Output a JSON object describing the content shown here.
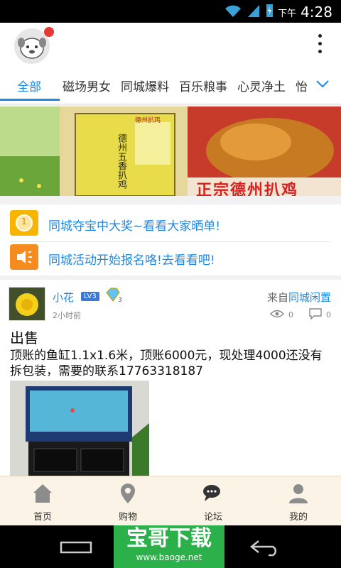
{
  "status_bar": {
    "period": "下午",
    "time": "4:28"
  },
  "tabs": {
    "items": [
      {
        "label": "全部",
        "active": true
      },
      {
        "label": "磁场男女"
      },
      {
        "label": "同城爆料"
      },
      {
        "label": "百乐粮事"
      },
      {
        "label": "心灵净土"
      },
      {
        "label": "怡"
      }
    ],
    "accent_color": "#1e88e5"
  },
  "banner": {
    "caption": "正宗德州扒鸡",
    "package_text": "德州五香扒鸡",
    "package_brand": "德州扒鸡"
  },
  "notices": [
    {
      "icon": "coin-icon",
      "icon_text": "1",
      "text": "同城夺宝中大奖~看看大家晒单!"
    },
    {
      "icon": "speaker-icon",
      "text": "同城活动开始报名咯!去看看吧!"
    }
  ],
  "post": {
    "username": "小花",
    "level": "LV3",
    "badge_number": "3",
    "from_label": "来自",
    "from_source": "同城闲置",
    "time": "2小时前",
    "views": "0",
    "comments": "0",
    "title": "出售",
    "body": "顶账的鱼缸1.1x1.6米，顶账6000元，现处理4000还没有拆包装，需要的联系17763318187"
  },
  "bottom_nav": [
    {
      "label": "首页",
      "icon": "home-icon"
    },
    {
      "label": "购物",
      "icon": "location-pin-icon"
    },
    {
      "label": "论坛",
      "icon": "chat-bubbles-icon",
      "active": true
    },
    {
      "label": "我的",
      "icon": "person-icon"
    }
  ],
  "watermark": {
    "title": "宝哥下载",
    "url": "www.baoge.net"
  }
}
